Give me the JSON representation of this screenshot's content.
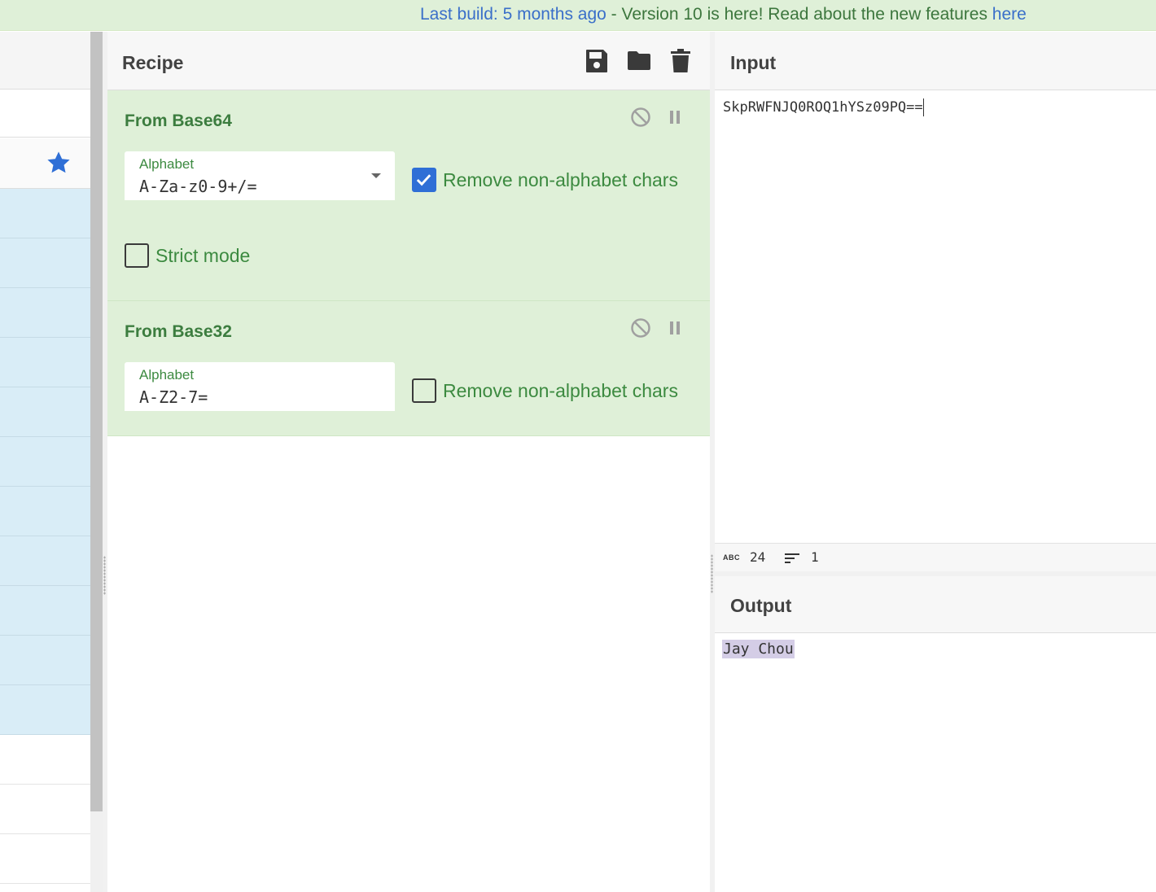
{
  "banner": {
    "build_prefix": "Last build: 5 months ago",
    "separator": " - ",
    "message": "Version 10 is here! Read about the new features ",
    "link": "here"
  },
  "operations": {
    "favourites_icon": "star-icon",
    "accent": "#2f6fd6",
    "row_highlight": "#d9edf7"
  },
  "recipe": {
    "title": "Recipe",
    "tools": [
      "save-icon",
      "folder-icon",
      "trash-icon"
    ],
    "ops": [
      {
        "name": "From Base64",
        "alphabet_label": "Alphabet",
        "alphabet_value": "A-Za-z0-9+/=",
        "remove_label": "Remove non-alphabet chars",
        "remove_checked": true,
        "strict_label": "Strict mode",
        "strict_checked": false
      },
      {
        "name": "From Base32",
        "alphabet_label": "Alphabet",
        "alphabet_value": "A-Z2-7=",
        "remove_label": "Remove non-alphabet chars",
        "remove_checked": false
      }
    ]
  },
  "input": {
    "title": "Input",
    "value": "SkpRWFNJQ0ROQ1hYSz09PQ==",
    "status": {
      "abc_label": "ABC",
      "length": "24",
      "lines": "1"
    }
  },
  "output": {
    "title": "Output",
    "value": "Jay Chou"
  }
}
